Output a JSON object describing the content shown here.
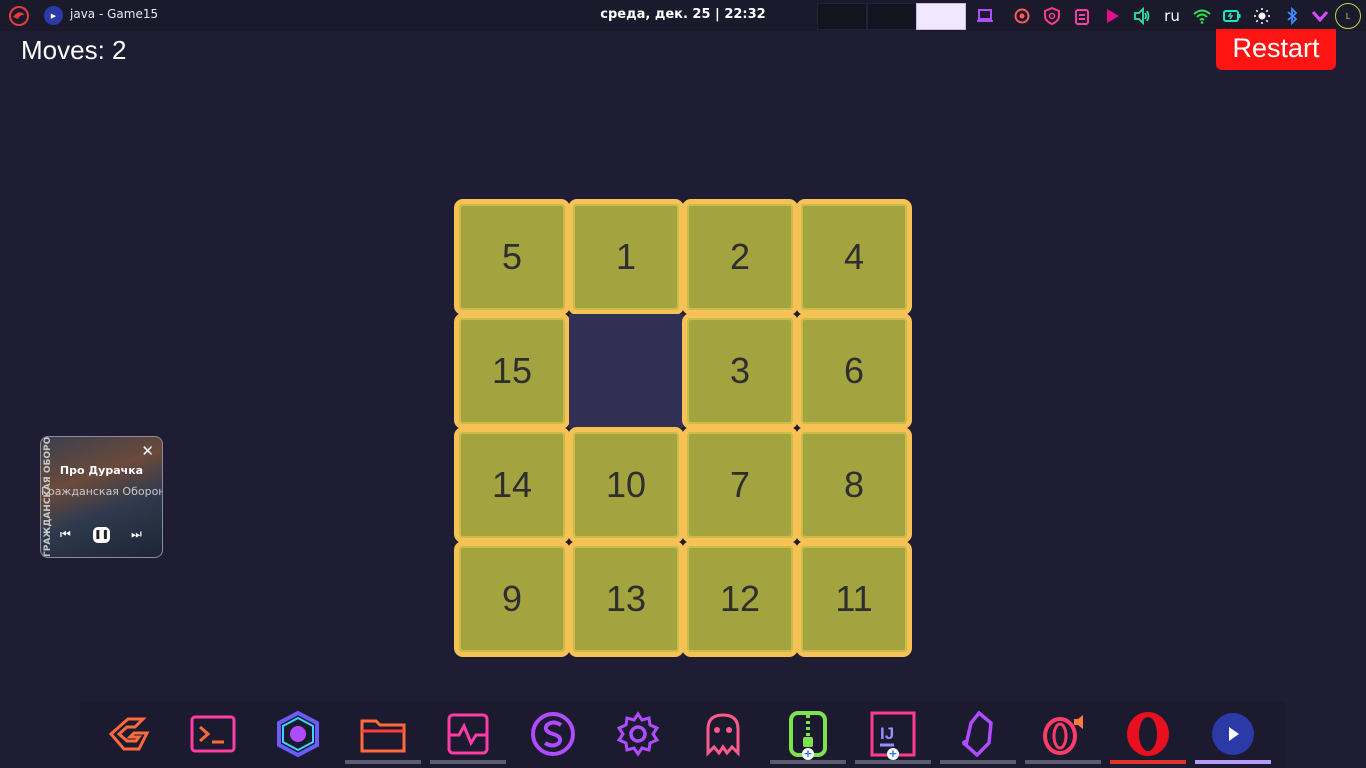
{
  "topbar": {
    "window_title": "java - Game15",
    "clock": "среда, дек. 25 | 22:32",
    "language": "ru",
    "tray_icons": [
      "laptop-icon",
      "power-profile-icon",
      "shield-icon",
      "clipboard-icon",
      "play-icon",
      "volume-icon",
      "wifi-icon",
      "battery-icon",
      "brightness-icon",
      "bluetooth-icon",
      "chevron-down-icon"
    ]
  },
  "game": {
    "moves_label": "Moves: 2",
    "restart_label": "Restart",
    "tiles": [
      "5",
      "1",
      "2",
      "4",
      "15",
      "",
      "3",
      "6",
      "14",
      "10",
      "7",
      "8",
      "9",
      "13",
      "12",
      "11"
    ]
  },
  "media": {
    "track": "Про Дурачка",
    "artist": "Гражданская Оборона",
    "album_spine": "ГРАЖДАНСКАЯ ОБОРОНА"
  },
  "dock": {
    "apps": [
      "app-launcher",
      "terminal",
      "stealth-app",
      "files",
      "system-monitor",
      "s-app",
      "settings",
      "ghost-app",
      "archive-manager",
      "intellij-idea",
      "obsidian",
      "opera-gx",
      "opera",
      "java-app"
    ]
  },
  "colors": {
    "background": "#1e1d33",
    "tile_fill": "#a3a43f",
    "tile_border": "#f6c155",
    "empty_cell": "#322f55",
    "restart": "#ff1414"
  }
}
